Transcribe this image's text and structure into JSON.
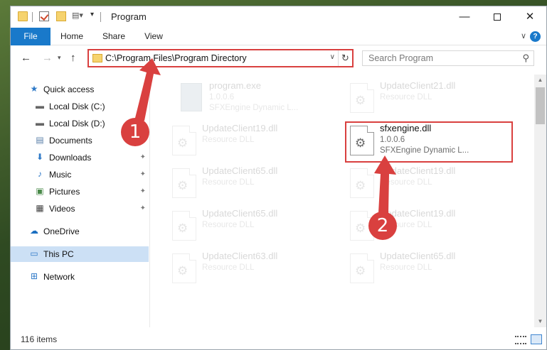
{
  "window": {
    "title": "Program"
  },
  "quick_access_toolbar": {
    "icons": [
      "folder-icon",
      "properties-icon",
      "new-folder-icon",
      "view-icon",
      "dropdown-icon"
    ]
  },
  "ribbon": {
    "tabs": [
      "File",
      "Home",
      "Share",
      "View"
    ]
  },
  "nav": {
    "address": "C:\\Program Files\\Program Directory",
    "search_placeholder": "Search Program"
  },
  "sidebar": {
    "items": [
      {
        "label": "Quick access",
        "icon": "star-icon"
      },
      {
        "label": "Local Disk (C:)",
        "icon": "drive-icon"
      },
      {
        "label": "Local Disk (D:)",
        "icon": "drive-icon"
      },
      {
        "label": "Documents",
        "icon": "documents-icon"
      },
      {
        "label": "Downloads",
        "icon": "download-icon",
        "pinned": true
      },
      {
        "label": "Music",
        "icon": "music-icon",
        "pinned": true
      },
      {
        "label": "Pictures",
        "icon": "pictures-icon",
        "pinned": true
      },
      {
        "label": "Videos",
        "icon": "videos-icon",
        "pinned": true
      },
      {
        "label": "OneDrive",
        "icon": "cloud-icon"
      },
      {
        "label": "This PC",
        "icon": "computer-icon",
        "selected": true
      },
      {
        "label": "Network",
        "icon": "network-icon"
      }
    ]
  },
  "files": [
    {
      "name": "program.exe",
      "line2": "1.0.0.6",
      "line3": "SFXEngine Dynamic L...",
      "faded": true
    },
    {
      "name": "UpdateClient21.dll",
      "line2": "Resource DLL",
      "faded": true
    },
    {
      "name": "UpdateClient19.dll",
      "line2": "Resource DLL",
      "faded": true
    },
    {
      "name": "sfxengine.dll",
      "line2": "1.0.0.6",
      "line3": "SFXEngine Dynamic L...",
      "faded": false
    },
    {
      "name": "UpdateClient65.dll",
      "line2": "Resource DLL",
      "faded": true
    },
    {
      "name": "UpdateClient19.dll",
      "line2": "Resource DLL",
      "faded": true
    },
    {
      "name": "UpdateClient65.dll",
      "line2": "Resource DLL",
      "faded": true
    },
    {
      "name": "UpdateClient19.dll",
      "line2": "Resource DLL",
      "faded": true
    },
    {
      "name": "UpdateClient63.dll",
      "line2": "Resource DLL",
      "faded": true
    },
    {
      "name": "UpdateClient65.dll",
      "line2": "Resource DLL",
      "faded": true
    }
  ],
  "status": {
    "item_count": "116 items"
  },
  "annotations": {
    "marker1": "1",
    "marker2": "2",
    "color": "#d9403f"
  }
}
